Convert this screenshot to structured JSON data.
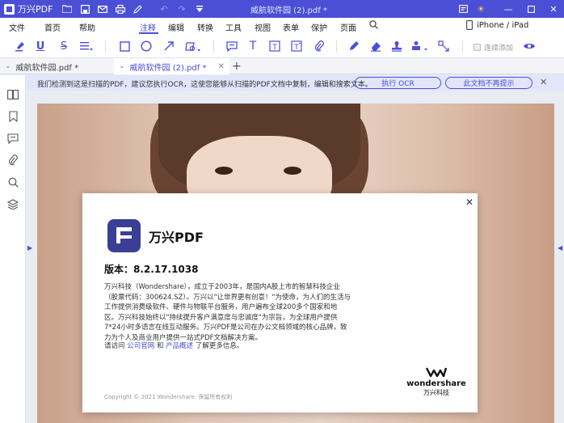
{
  "titlebar": {
    "app_name": "万兴PDF",
    "doc_title": "威航软件园 (2).pdf *",
    "icons": [
      "folder-icon",
      "save-icon",
      "mail-icon",
      "print-icon",
      "edit-icon",
      "undo-icon",
      "redo-icon",
      "dropdown-icon"
    ],
    "accent": "#4a4fd6"
  },
  "menubar": {
    "items": [
      "文件",
      "首页",
      "帮助",
      "注释",
      "编辑",
      "转换",
      "工具",
      "视图",
      "表单",
      "保护",
      "页面"
    ],
    "active": "注释",
    "device": "iPhone / iPad"
  },
  "toolbar": {
    "continuous_add": "连续添加"
  },
  "tabs": [
    {
      "label": "威航软件园.pdf *"
    },
    {
      "label": "威航软件园 (2).pdf *",
      "active": true
    }
  ],
  "ocr_bar": {
    "message": "我们检测到这是扫描的PDF，建议您执行OCR，这使您能够从扫描的PDF文档中复制，编辑和搜索文本。",
    "perform_ocr": "执行 OCR",
    "dont_remind": "此文档不再提示"
  },
  "about": {
    "product": "万兴PDF",
    "version": "版本：8.2.17.1038",
    "description": "万兴科技（Wondershare），成立于2003年，是国内A股上市的智慧科技企业（股票代码：300624.SZ）。万兴以\"让世界更有创意！\"为使命，为人们的生活与工作提供消费级软件、硬件与物联平台服务，用户遍布全球200多个国家和地区。万兴科技始终以\"持续提升客户满意度与忠诚度\"为宗旨，为全球用户提供7*24小时多语言在线互动服务。万兴PDF是公司在办公文档领域的核心品牌，致力为个人及商业用户提供一站式PDF文档解决方案。",
    "visit_prefix": "请访问",
    "link_site": "公司官网",
    "visit_and": "和",
    "link_overview": "产品概述",
    "visit_suffix": "了解更多信息。",
    "copyright": "Copyright © 2021 Wondershare. 保留所有权利",
    "brand_en": "wondershare",
    "brand_cn": "万兴科技"
  }
}
